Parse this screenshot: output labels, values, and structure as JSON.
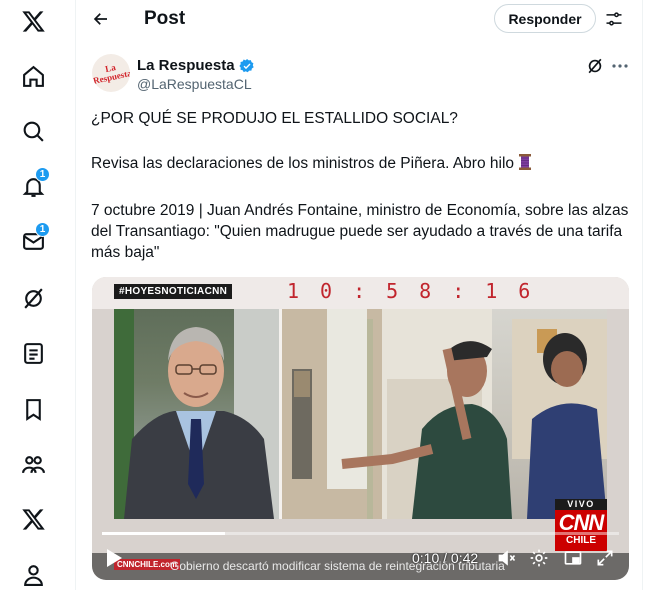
{
  "header": {
    "title": "Post",
    "reply_label": "Responder"
  },
  "nav": {
    "notifications_badge": "1",
    "messages_badge": "1"
  },
  "post": {
    "author_name": "La Respuesta",
    "author_handle": "@LaRespuestaCL",
    "avatar_text": "La Respuesta",
    "line1": "¿POR QUÉ SE PRODUJO EL ESTALLIDO SOCIAL?",
    "line2": "Revisa las declaraciones de los ministros de Piñera. Abro hilo",
    "line3": "7 octubre 2019 | Juan Andrés Fontaine, ministro de Economía, sobre las alzas del Transantiago: \"Quien madrugue puede ser ayudado a través de una tarifa más baja\""
  },
  "video": {
    "hashtag": "#HOYESNOTICIACNN",
    "clock": "10:58:16",
    "caption": "Gobierno descartó modificar sistema de reintegración tributaria",
    "ticker_logo": "CNNCHILE.com",
    "live_label": "VIVO",
    "logo_main": "CNN",
    "logo_sub": "CHILE",
    "time_display": "0:10 / 0:42",
    "progress": 0.238
  },
  "colors": {
    "accent": "#1d9bf0",
    "cnn_red": "#cc0000"
  }
}
